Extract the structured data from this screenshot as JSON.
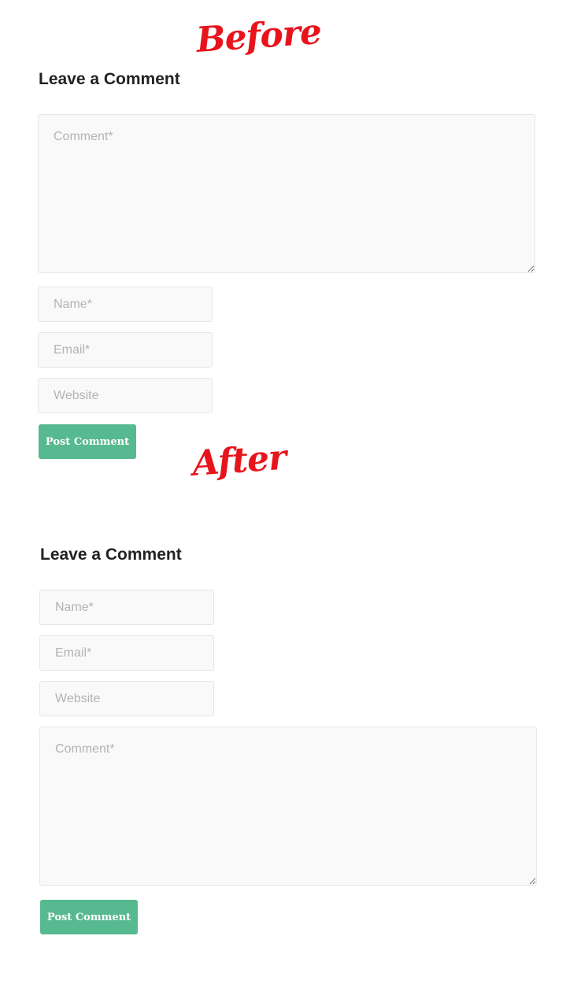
{
  "annotations": {
    "before": "Before",
    "after": "After",
    "color": "#e8141c"
  },
  "before_form": {
    "heading": "Leave a Comment",
    "comment_placeholder": "Comment*",
    "name_placeholder": "Name*",
    "email_placeholder": "Email*",
    "website_placeholder": "Website",
    "submit_label": "Post Comment"
  },
  "after_form": {
    "heading": "Leave a Comment",
    "name_placeholder": "Name*",
    "email_placeholder": "Email*",
    "website_placeholder": "Website",
    "comment_placeholder": "Comment*",
    "submit_label": "Post Comment"
  },
  "colors": {
    "button": "#57b98f",
    "field_background": "#f9f9f9",
    "placeholder": "#b3b3b3",
    "heading": "#222222"
  }
}
